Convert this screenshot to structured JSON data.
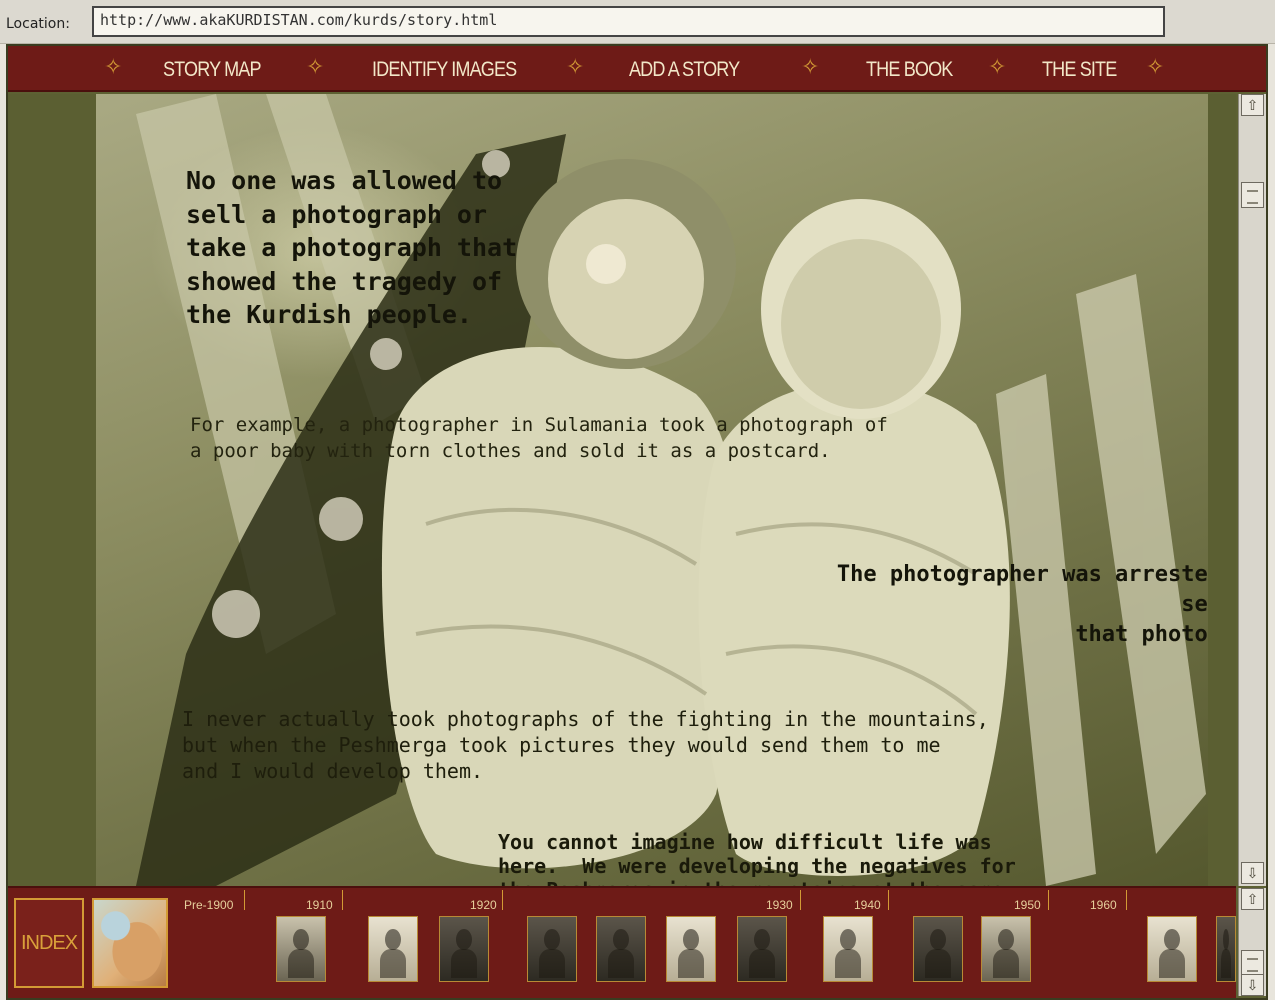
{
  "location": {
    "label": "Location:",
    "url": "http://www.akaKURDISTAN.com/kurds/story.html"
  },
  "nav": {
    "items": [
      "STORY MAP",
      "IDENTIFY IMAGES",
      "ADD A STORY",
      "THE BOOK",
      "THE SITE"
    ]
  },
  "story": {
    "block1": "No one was allowed to\nsell a photograph or\ntake a photograph that\nshowed the tragedy of\nthe Kurdish people.",
    "block2": "For example, a photographer in Sulamania took a photograph of\na poor baby with torn clothes and sold it as a postcard.",
    "block3": "The photographer was arrested for\nselling\nthat photograph",
    "block4": "I never actually took photographs of the fighting in the mountains,\nbut when the Peshmerga took pictures they would send them to me\nand I would develop them.",
    "block5": "You cannot imagine how difficult life was\nhere.  We were developing the negatives for\nthe Peshmerga in the mountains at the same"
  },
  "timeline": {
    "index_label": "INDEX",
    "decades": [
      "Pre-1900",
      "1910",
      "1920",
      "1930",
      "1940",
      "1950",
      "1960"
    ]
  },
  "scrollbar": {
    "up_icon": "arrow-up-icon",
    "down_icon": "arrow-down-icon"
  }
}
